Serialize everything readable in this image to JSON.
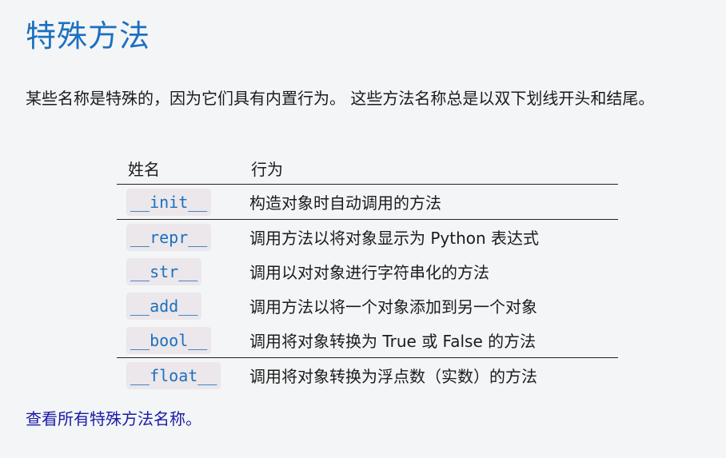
{
  "title": "特殊方法",
  "intro": "某些名称是特殊的，因为它们具有内置行为。 这些方法名称总是以双下划线开头和结尾。",
  "table": {
    "headers": [
      "姓名",
      "行为"
    ],
    "rows": [
      {
        "name": "__init__",
        "behavior": "构造对象时自动调用的方法"
      },
      {
        "name": "__repr__",
        "behavior": "调用方法以将对象显示为 Python 表达式"
      },
      {
        "name": "__str__",
        "behavior": "调用以对对象进行字符串化的方法"
      },
      {
        "name": "__add__",
        "behavior": "调用方法以将一个对象添加到另一个对象"
      },
      {
        "name": "__bool__",
        "behavior": "调用将对象转换为 True 或 False 的方法"
      },
      {
        "name": "__float__",
        "behavior": "调用将对象转换为浮点数（实数）的方法"
      }
    ]
  },
  "footer_link": "查看所有特殊方法名称。"
}
